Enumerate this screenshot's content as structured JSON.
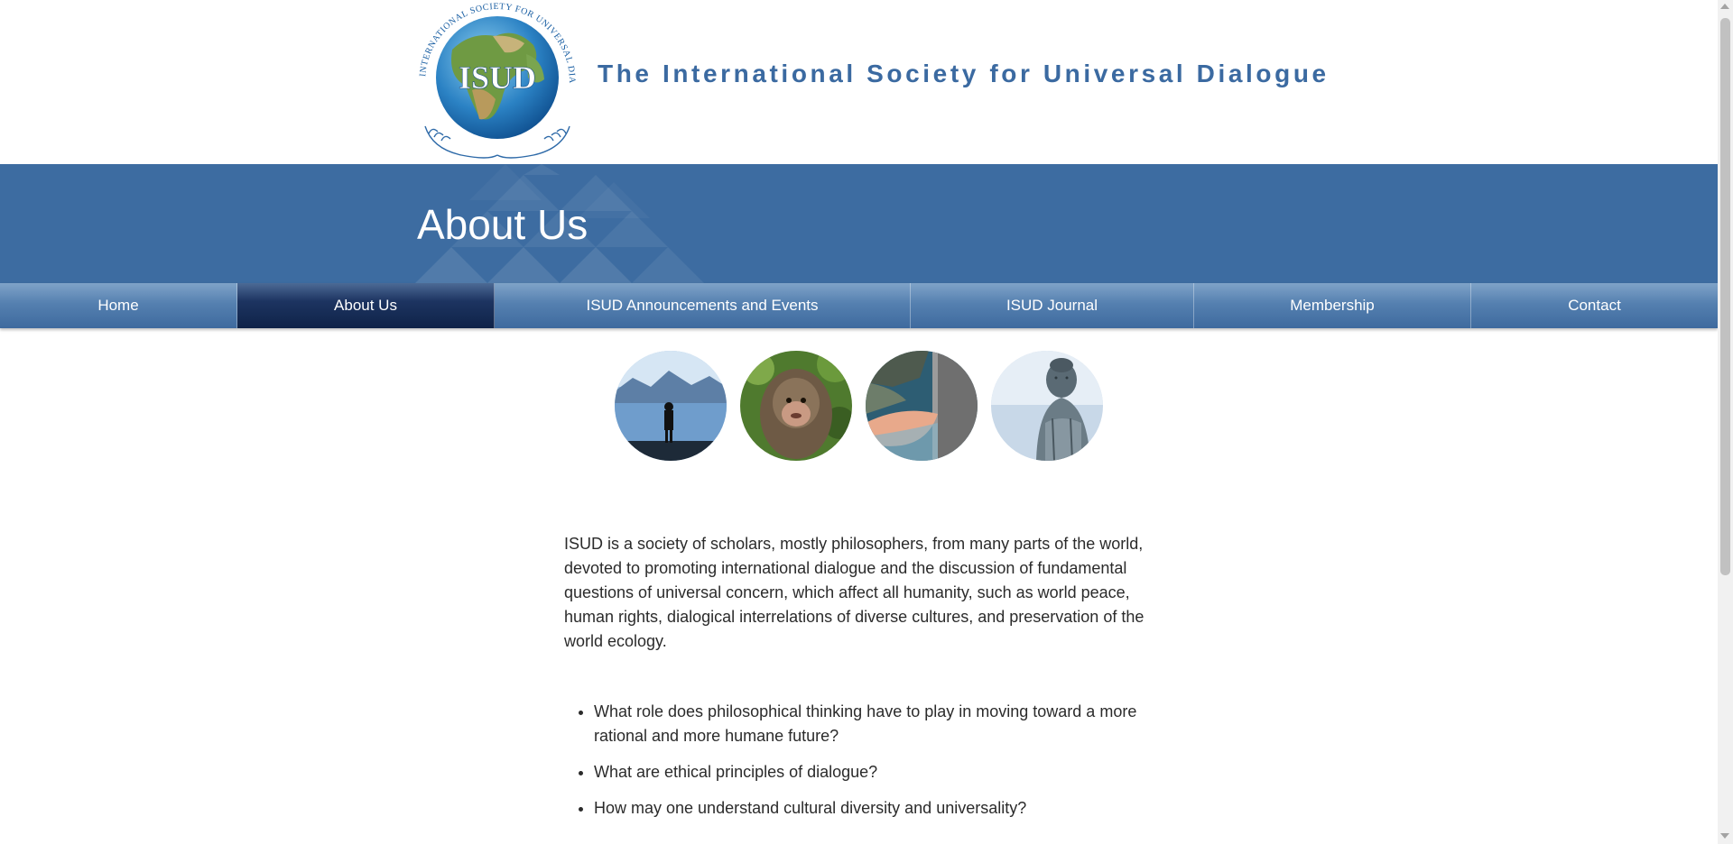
{
  "header": {
    "logo_name": "isud-globe-logo",
    "logo_text": "ISUD",
    "logo_ring_text": "INTERNATIONAL SOCIETY FOR UNIVERSAL DIALOGUE",
    "site_title": "The International Society for Universal Dialogue"
  },
  "banner": {
    "title": "About Us"
  },
  "nav": {
    "items": [
      {
        "label": "Home"
      },
      {
        "label": "About Us",
        "active": true
      },
      {
        "label": "ISUD Announcements and Events"
      },
      {
        "label": "ISUD Journal"
      },
      {
        "label": "Membership"
      },
      {
        "label": "Contact"
      }
    ]
  },
  "gallery": {
    "images": [
      "person-at-lake",
      "monkey",
      "hand-in-water",
      "buddha-statue"
    ]
  },
  "content": {
    "intro": "ISUD is a society of scholars, mostly philosophers, from many parts of the world, devoted to promoting international dialogue and the discussion of fundamental questions of universal concern, which affect all humanity, such as world peace, human rights, dialogical interrelations of diverse cultures, and preservation of the world ecology.",
    "questions": [
      "What role does philosophical thinking have to play in moving toward a more rational and more humane future?",
      "What are ethical principles of dialogue?",
      "How may one understand cultural diversity and universality?"
    ]
  },
  "colors": {
    "brand_blue": "#3b6aa1",
    "banner_blue": "#3d6ca1",
    "nav_active": "#1d3461",
    "text": "#2b2b2b"
  }
}
